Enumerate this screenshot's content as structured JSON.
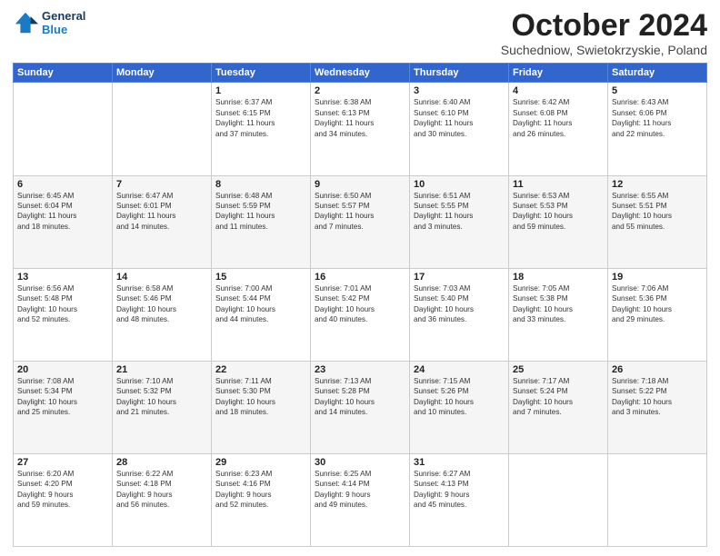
{
  "header": {
    "logo_line1": "General",
    "logo_line2": "Blue",
    "month": "October 2024",
    "location": "Suchedniow, Swietokrzyskie, Poland"
  },
  "days_of_week": [
    "Sunday",
    "Monday",
    "Tuesday",
    "Wednesday",
    "Thursday",
    "Friday",
    "Saturday"
  ],
  "weeks": [
    [
      {
        "day": "",
        "text": ""
      },
      {
        "day": "",
        "text": ""
      },
      {
        "day": "1",
        "text": "Sunrise: 6:37 AM\nSunset: 6:15 PM\nDaylight: 11 hours\nand 37 minutes."
      },
      {
        "day": "2",
        "text": "Sunrise: 6:38 AM\nSunset: 6:13 PM\nDaylight: 11 hours\nand 34 minutes."
      },
      {
        "day": "3",
        "text": "Sunrise: 6:40 AM\nSunset: 6:10 PM\nDaylight: 11 hours\nand 30 minutes."
      },
      {
        "day": "4",
        "text": "Sunrise: 6:42 AM\nSunset: 6:08 PM\nDaylight: 11 hours\nand 26 minutes."
      },
      {
        "day": "5",
        "text": "Sunrise: 6:43 AM\nSunset: 6:06 PM\nDaylight: 11 hours\nand 22 minutes."
      }
    ],
    [
      {
        "day": "6",
        "text": "Sunrise: 6:45 AM\nSunset: 6:04 PM\nDaylight: 11 hours\nand 18 minutes."
      },
      {
        "day": "7",
        "text": "Sunrise: 6:47 AM\nSunset: 6:01 PM\nDaylight: 11 hours\nand 14 minutes."
      },
      {
        "day": "8",
        "text": "Sunrise: 6:48 AM\nSunset: 5:59 PM\nDaylight: 11 hours\nand 11 minutes."
      },
      {
        "day": "9",
        "text": "Sunrise: 6:50 AM\nSunset: 5:57 PM\nDaylight: 11 hours\nand 7 minutes."
      },
      {
        "day": "10",
        "text": "Sunrise: 6:51 AM\nSunset: 5:55 PM\nDaylight: 11 hours\nand 3 minutes."
      },
      {
        "day": "11",
        "text": "Sunrise: 6:53 AM\nSunset: 5:53 PM\nDaylight: 10 hours\nand 59 minutes."
      },
      {
        "day": "12",
        "text": "Sunrise: 6:55 AM\nSunset: 5:51 PM\nDaylight: 10 hours\nand 55 minutes."
      }
    ],
    [
      {
        "day": "13",
        "text": "Sunrise: 6:56 AM\nSunset: 5:48 PM\nDaylight: 10 hours\nand 52 minutes."
      },
      {
        "day": "14",
        "text": "Sunrise: 6:58 AM\nSunset: 5:46 PM\nDaylight: 10 hours\nand 48 minutes."
      },
      {
        "day": "15",
        "text": "Sunrise: 7:00 AM\nSunset: 5:44 PM\nDaylight: 10 hours\nand 44 minutes."
      },
      {
        "day": "16",
        "text": "Sunrise: 7:01 AM\nSunset: 5:42 PM\nDaylight: 10 hours\nand 40 minutes."
      },
      {
        "day": "17",
        "text": "Sunrise: 7:03 AM\nSunset: 5:40 PM\nDaylight: 10 hours\nand 36 minutes."
      },
      {
        "day": "18",
        "text": "Sunrise: 7:05 AM\nSunset: 5:38 PM\nDaylight: 10 hours\nand 33 minutes."
      },
      {
        "day": "19",
        "text": "Sunrise: 7:06 AM\nSunset: 5:36 PM\nDaylight: 10 hours\nand 29 minutes."
      }
    ],
    [
      {
        "day": "20",
        "text": "Sunrise: 7:08 AM\nSunset: 5:34 PM\nDaylight: 10 hours\nand 25 minutes."
      },
      {
        "day": "21",
        "text": "Sunrise: 7:10 AM\nSunset: 5:32 PM\nDaylight: 10 hours\nand 21 minutes."
      },
      {
        "day": "22",
        "text": "Sunrise: 7:11 AM\nSunset: 5:30 PM\nDaylight: 10 hours\nand 18 minutes."
      },
      {
        "day": "23",
        "text": "Sunrise: 7:13 AM\nSunset: 5:28 PM\nDaylight: 10 hours\nand 14 minutes."
      },
      {
        "day": "24",
        "text": "Sunrise: 7:15 AM\nSunset: 5:26 PM\nDaylight: 10 hours\nand 10 minutes."
      },
      {
        "day": "25",
        "text": "Sunrise: 7:17 AM\nSunset: 5:24 PM\nDaylight: 10 hours\nand 7 minutes."
      },
      {
        "day": "26",
        "text": "Sunrise: 7:18 AM\nSunset: 5:22 PM\nDaylight: 10 hours\nand 3 minutes."
      }
    ],
    [
      {
        "day": "27",
        "text": "Sunrise: 6:20 AM\nSunset: 4:20 PM\nDaylight: 9 hours\nand 59 minutes."
      },
      {
        "day": "28",
        "text": "Sunrise: 6:22 AM\nSunset: 4:18 PM\nDaylight: 9 hours\nand 56 minutes."
      },
      {
        "day": "29",
        "text": "Sunrise: 6:23 AM\nSunset: 4:16 PM\nDaylight: 9 hours\nand 52 minutes."
      },
      {
        "day": "30",
        "text": "Sunrise: 6:25 AM\nSunset: 4:14 PM\nDaylight: 9 hours\nand 49 minutes."
      },
      {
        "day": "31",
        "text": "Sunrise: 6:27 AM\nSunset: 4:13 PM\nDaylight: 9 hours\nand 45 minutes."
      },
      {
        "day": "",
        "text": ""
      },
      {
        "day": "",
        "text": ""
      }
    ]
  ]
}
